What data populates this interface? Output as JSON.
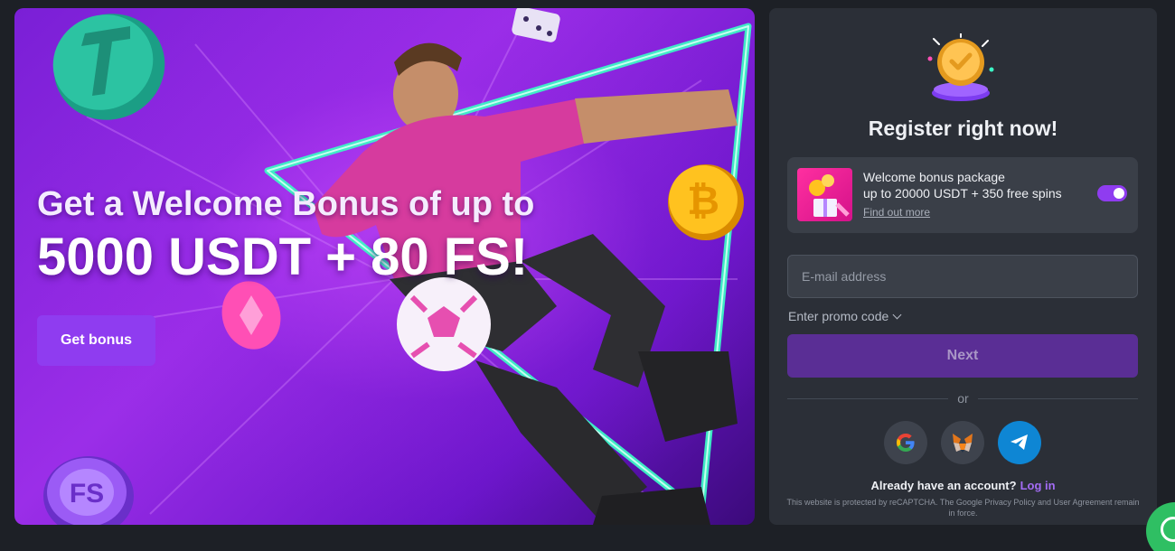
{
  "banner": {
    "headline_line1": "Get a Welcome Bonus of up to",
    "headline_line2": "5000 USDT + 80 FS!",
    "cta_label": "Get bonus",
    "chip_text": "FS"
  },
  "register": {
    "title": "Register right now!",
    "bonus_card": {
      "title": "Welcome bonus package",
      "subtitle": "up to 20000 USDT + 350 free spins",
      "link": "Find out more",
      "toggle_on": true
    },
    "email_placeholder": "E-mail address",
    "promo_label": "Enter promo code",
    "next_label": "Next",
    "divider_text": "or",
    "social": [
      "google-icon",
      "metamask-icon",
      "telegram-icon"
    ],
    "have_account": "Already have an account?",
    "login_label": "Log in",
    "recaptcha_notice": "This website is protected by reCAPTCHA. The Google Privacy Policy and User Agreement remain in force."
  },
  "colors": {
    "accent": "#8f3cf0",
    "panel_bg": "#2b2f37",
    "page_bg": "#1d2026",
    "telegram": "#0e86d4",
    "chat": "#2fbf63"
  }
}
